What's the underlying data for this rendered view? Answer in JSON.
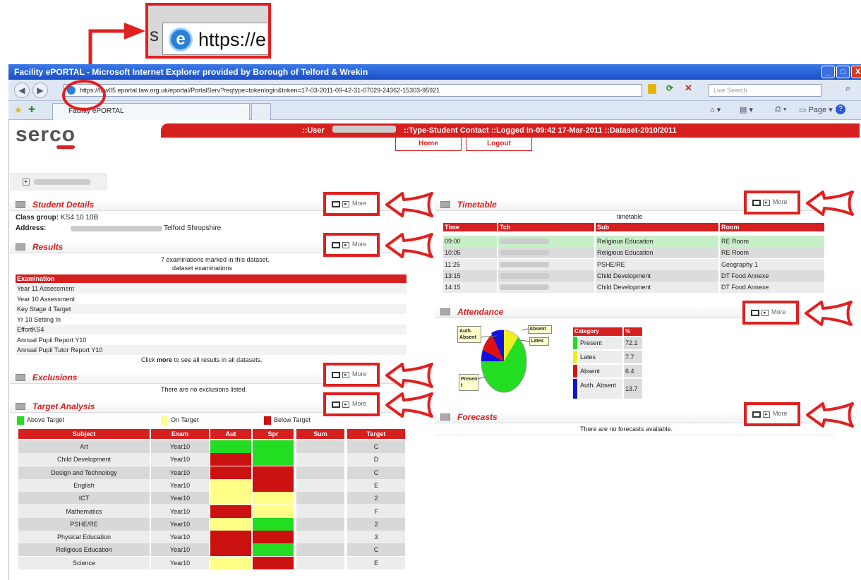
{
  "callout": {
    "zoom_left": "s",
    "zoom_text": "https://e"
  },
  "window": {
    "title": "Facility ePORTAL - Microsoft Internet Explorer provided by Borough of Telford & Wrekin",
    "url": "https://taw05.eportal.taw.org.uk/eportal/PortalServ?reqtype=tokenlogin&token=17-03-2011-09-42-31-07029-24362-15303-95921",
    "search_placeholder": "Live Search",
    "tab_label": "Facility ePORTAL",
    "page_menu": "Page",
    "min": "_",
    "max": "□",
    "close": "X"
  },
  "header": {
    "logo": "serco",
    "user_label": "::User",
    "info": "::Type-Student Contact ::Logged In-09:42 17-Mar-2011 ::Dataset-2010/2011",
    "home": "Home",
    "logout": "Logout"
  },
  "more_label": "More",
  "student": {
    "title": "Student Details",
    "class_label": "Class group:",
    "class_value": "KS4 10 10B",
    "address_label": "Address:",
    "address_value": "Telford Shropshire"
  },
  "results": {
    "title": "Results",
    "line1": "7 examinations marked in this dataset.",
    "line2": "dataset examinations",
    "header": "Examination",
    "rows": [
      "Year 11 Assessment",
      "Year 10 Assessment",
      "Key Stage 4 Target",
      "Yr 10 Setting In",
      "EffortKS4",
      "Annual Pupil Report Y10",
      "Annual Pupil Tutor Report Y10"
    ],
    "footer_pre": "Click ",
    "footer_bold": "more",
    "footer_post": " to see all results in all datasets."
  },
  "exclusions": {
    "title": "Exclusions",
    "text": "There are no exclusions listed."
  },
  "target": {
    "title": "Target Analysis",
    "legend": [
      "Above Target",
      "On Target",
      "Below Target"
    ],
    "legend_colors": [
      "#22dd22",
      "#ffff88",
      "#cc1111"
    ],
    "headers": [
      "Subject",
      "Exam",
      "Aut",
      "Spr",
      "Sum",
      "Target"
    ],
    "rows": [
      {
        "subject": "Art",
        "exam": "Year10",
        "aut": "green",
        "spr": "green",
        "target": "C"
      },
      {
        "subject": "Child Development",
        "exam": "Year10",
        "aut": "red",
        "spr": "green",
        "target": "D"
      },
      {
        "subject": "Design and Technology",
        "exam": "Year10",
        "aut": "red",
        "spr": "red",
        "target": "C"
      },
      {
        "subject": "English",
        "exam": "Year10",
        "aut": "yellow",
        "spr": "red",
        "target": "E"
      },
      {
        "subject": "ICT",
        "exam": "Year10",
        "aut": "yellow",
        "spr": "yellow",
        "target": "2"
      },
      {
        "subject": "Mathematics",
        "exam": "Year10",
        "aut": "red",
        "spr": "yellow",
        "target": "F"
      },
      {
        "subject": "PSHE/RE",
        "exam": "Year10",
        "aut": "yellow",
        "spr": "green",
        "target": "2"
      },
      {
        "subject": "Physical Education",
        "exam": "Year10",
        "aut": "red",
        "spr": "red",
        "target": "3"
      },
      {
        "subject": "Religious Education",
        "exam": "Year10",
        "aut": "red",
        "spr": "green",
        "target": "C"
      },
      {
        "subject": "Science",
        "exam": "Year10",
        "aut": "yellow",
        "spr": "red",
        "target": "E"
      }
    ]
  },
  "timetable": {
    "title": "Timetable",
    "caption": "timetable",
    "headers": [
      "Time",
      "Tch",
      "Sub",
      "Room"
    ],
    "rows": [
      {
        "time": "09:00",
        "sub": "Religious Education",
        "room": "RE Room"
      },
      {
        "time": "10:05",
        "sub": "Religious Education",
        "room": "RE Room"
      },
      {
        "time": "11:25",
        "sub": "PSHE/RE",
        "room": "Geography 1"
      },
      {
        "time": "13:15",
        "sub": "Child Development",
        "room": "DT Food Annexe"
      },
      {
        "time": "14:15",
        "sub": "Child Development",
        "room": "DT Food Annexe"
      }
    ]
  },
  "attendance": {
    "title": "Attendance",
    "pie_labels": [
      "Auth. Absent",
      "Absent",
      "Lates",
      "Presen t"
    ],
    "headers": [
      "Category",
      "%"
    ],
    "rows": [
      {
        "cat": "Present",
        "val": "72.1",
        "color": "#22dd22"
      },
      {
        "cat": "Lates",
        "val": "7.7",
        "color": "#eeee22"
      },
      {
        "cat": "Absent",
        "val": "6.4",
        "color": "#dd1111"
      },
      {
        "cat": "Auth. Absent",
        "val": "13.7",
        "color": "#1111dd"
      }
    ]
  },
  "forecasts": {
    "title": "Forecasts",
    "text": "There are no forecasts available."
  }
}
